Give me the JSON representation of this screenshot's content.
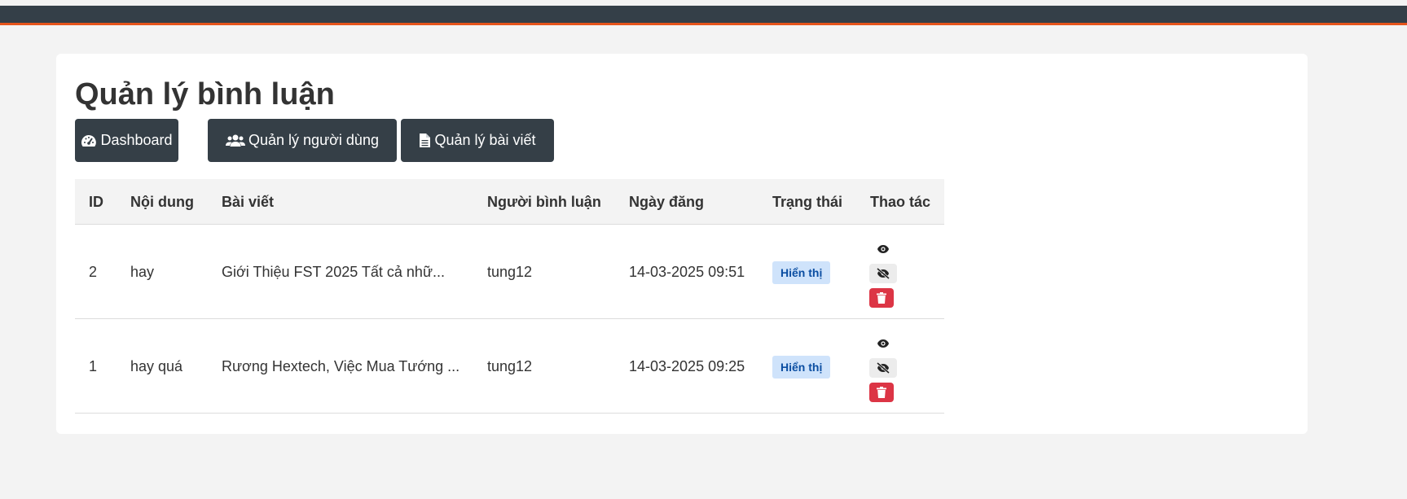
{
  "page": {
    "title": "Quản lý bình luận"
  },
  "nav": {
    "dashboard": "Dashboard",
    "users": "Quản lý người dùng",
    "posts": "Quản lý bài viết"
  },
  "table": {
    "headers": {
      "id": "ID",
      "content": "Nội dung",
      "post": "Bài viết",
      "user": "Người bình luận",
      "date": "Ngày đăng",
      "status": "Trạng thái",
      "actions": "Thao tác"
    },
    "rows": [
      {
        "id": "2",
        "content": "hay",
        "post": "Giới Thiệu FST 2025 Tất cả nhữ...",
        "user": "tung12",
        "date": "14-03-2025 09:51",
        "status": "Hiển thị"
      },
      {
        "id": "1",
        "content": "hay quá",
        "post": "Rương Hextech, Việc Mua Tướng ...",
        "user": "tung12",
        "date": "14-03-2025 09:25",
        "status": "Hiển thị"
      }
    ]
  },
  "colors": {
    "topbar": "#343f48",
    "accent": "#e5541b",
    "nav_button": "#353f47",
    "badge_bg": "#cfe3fb",
    "badge_text": "#0b4ea2",
    "delete": "#dc3545"
  },
  "icons": {
    "dashboard": "tachometer-icon",
    "users": "users-icon",
    "posts": "file-icon",
    "view": "eye-icon",
    "hide": "eye-slash-icon",
    "delete": "trash-icon"
  }
}
